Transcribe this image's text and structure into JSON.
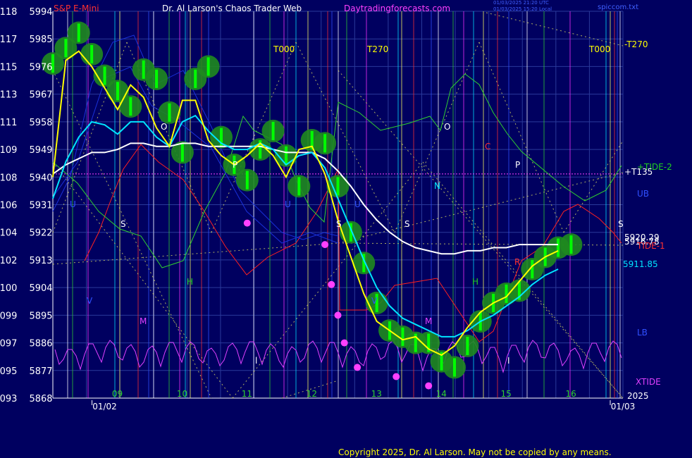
{
  "header": {
    "symbol": "S&P E-Mini",
    "title": "Dr. Al Larson's Chaos Trader Web",
    "site": "Daytradingforecasts.com",
    "file": "spiccom.txt",
    "stamp1": "01/03/2025 21:20 UTC",
    "stamp2": "01/03/2025 15:20 Local"
  },
  "copyright": "Copyright 2025, Dr. Al Larson. May not be copied by any means.",
  "colors": {
    "background": "#000060",
    "grid": "#2a3a9a",
    "price_bars": "#00ff00",
    "ema_fast": "#ffff00",
    "ema_mid": "#00e5ff",
    "ema_slow": "#ffffff",
    "red_line": "#ff2020",
    "green_line": "#30d030",
    "blue_line": "#1a30d8",
    "magenta_osc": "#e040ff",
    "highlight": "#1f8a1f"
  },
  "chart_data": {
    "type": "line",
    "title": "S&P E-Mini",
    "y_axis": {
      "range": [
        5868,
        5994
      ],
      "tick_values": [
        5994,
        5985,
        5976,
        5967,
        5958,
        5949,
        5940,
        5931,
        5922,
        5913,
        5904,
        5895,
        5886,
        5877,
        5868
      ],
      "secondary_ticks": [
        "118",
        "117",
        "115",
        "113",
        "111",
        "109",
        "108",
        "106",
        "104",
        "102",
        "100",
        "099",
        "097",
        "095",
        "093"
      ]
    },
    "x_axis": {
      "range": [
        8,
        16.8
      ],
      "hour_ticks": [
        {
          "x": 9,
          "label": "09"
        },
        {
          "x": 10,
          "label": "10"
        },
        {
          "x": 11,
          "label": "11"
        },
        {
          "x": 12,
          "label": "12"
        },
        {
          "x": 13,
          "label": "13"
        },
        {
          "x": 14,
          "label": "14"
        },
        {
          "x": 15,
          "label": "15"
        },
        {
          "x": 16,
          "label": "16"
        },
        {
          "x": 8.98,
          "label": "09"
        },
        {
          "x": 9.98,
          "label": "10"
        },
        {
          "x": 10.98,
          "label": "11"
        },
        {
          "x": 11.98,
          "label": "12"
        },
        {
          "x": 12.98,
          "label": "13"
        },
        {
          "x": 13.98,
          "label": "14"
        },
        {
          "x": 14.98,
          "label": "15"
        },
        {
          "x": 15.98,
          "label": "16"
        }
      ],
      "date_labels": [
        {
          "x": 8.8,
          "label": "01/02"
        },
        {
          "x": 16.8,
          "label": "01/03"
        }
      ]
    },
    "grid": true,
    "year_label": "2025",
    "price": {
      "name": "S&P E-Mini",
      "x": [
        8.0,
        8.2,
        8.4,
        8.6,
        8.8,
        9.0,
        9.2,
        9.4,
        9.6,
        9.8,
        10.0,
        10.2,
        10.4,
        10.6,
        10.8,
        11.0,
        11.2,
        11.4,
        11.6,
        11.8,
        12.0,
        12.2,
        12.4,
        12.6,
        12.8,
        13.0,
        13.2,
        13.4,
        13.6,
        13.8,
        14.0,
        14.2,
        14.4,
        14.6,
        14.8,
        15.0,
        15.2,
        15.4,
        15.6,
        15.8,
        16.0
      ],
      "y": [
        5977,
        5982,
        5987,
        5980,
        5973,
        5968,
        5963,
        5975,
        5972,
        5961,
        5948,
        5972,
        5976,
        5953,
        5944,
        5939,
        5949,
        5955,
        5947,
        5937,
        5952,
        5951,
        5937,
        5922,
        5912,
        5899,
        5890,
        5888,
        5886,
        5886,
        5880,
        5878,
        5885,
        5893,
        5899,
        5902,
        5903,
        5910,
        5914,
        5917,
        5918
      ]
    },
    "ema_fast": [
      5940,
      5978,
      5981,
      5976,
      5969,
      5962,
      5970,
      5966,
      5956,
      5950,
      5965,
      5965,
      5952,
      5947,
      5944,
      5947,
      5951,
      5947,
      5940,
      5949,
      5950,
      5941,
      5926,
      5914,
      5902,
      5893,
      5890,
      5887,
      5888,
      5884,
      5882,
      5885,
      5891,
      5896,
      5899,
      5901,
      5906,
      5911,
      5914,
      5916
    ],
    "ema_mid": [
      5933,
      5945,
      5953,
      5958,
      5957,
      5954,
      5958,
      5958,
      5953,
      5950,
      5958,
      5960,
      5955,
      5951,
      5949,
      5949,
      5951,
      5949,
      5944,
      5947,
      5948,
      5943,
      5933,
      5923,
      5913,
      5904,
      5898,
      5894,
      5892,
      5890,
      5888,
      5888,
      5890,
      5893,
      5895,
      5898,
      5901,
      5905,
      5908,
      5910
    ],
    "ema_slow": [
      5941,
      5944,
      5946,
      5948,
      5948,
      5949,
      5951,
      5951,
      5950,
      5950,
      5951,
      5951,
      5950,
      5950,
      5950,
      5950,
      5950,
      5949,
      5948,
      5948,
      5948,
      5946,
      5942,
      5937,
      5931,
      5926,
      5922,
      5919,
      5917,
      5916,
      5915,
      5915,
      5916,
      5916,
      5917,
      5917,
      5918,
      5918,
      5918,
      5918
    ],
    "levels": [
      {
        "name": "+T135",
        "value": 5941
      },
      {
        "name": "+TIDE-2",
        "value": 5944
      },
      {
        "name": "5920.29",
        "value": 5920.29
      },
      {
        "name": "5916.78",
        "value": 5916.78
      },
      {
        "name": "+TIDE-1",
        "value": 5913
      },
      {
        "name": "5911.85",
        "value": 5911.85
      }
    ],
    "annotations": [
      "T000",
      "T270",
      "T000",
      "-T270",
      "O",
      "P",
      "S",
      "U",
      "H",
      "M",
      "V",
      "N",
      "C",
      "R",
      "UB",
      "LB",
      "XTIDE"
    ]
  },
  "labels": {
    "t000_a": "T000",
    "t270_a": "T270",
    "t000_b": "T000",
    "t270_right": "-T270",
    "tide2": "+TIDE-2",
    "t135": "+T135",
    "ub": "UB",
    "lb": "LB",
    "xtide": "XTIDE",
    "tide1": "TIDE-1",
    "v1": "5920.29",
    "v2": "5916.78",
    "v3": "5911.85",
    "o1": "O",
    "o2": "O",
    "p1": "P",
    "p2": "P",
    "s1": "S",
    "s2": "S",
    "s3": "S",
    "s4": "S",
    "u1": "U",
    "u2": "U",
    "u3": "U",
    "h1": "H",
    "h2": "H",
    "m1": "M",
    "m2": "M",
    "v_1": "V",
    "v_2": "V",
    "n": "N",
    "c": "C",
    "r": "R",
    "l": "l",
    "i": "I"
  }
}
